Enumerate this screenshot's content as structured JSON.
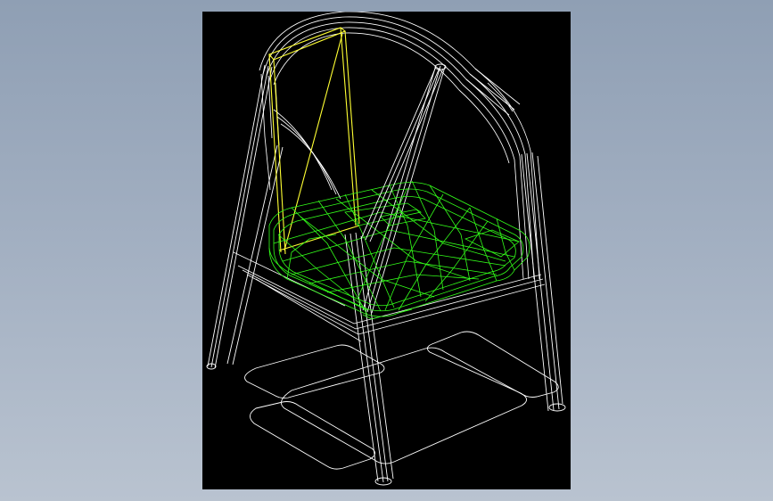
{
  "viewport": {
    "background_color": "#000000",
    "render_mode": "wireframe",
    "model": "chair"
  },
  "colors": {
    "app_background_top": "#8f9fb4",
    "app_background_bottom": "#b9c3d0",
    "frame_lines": "#ffffff",
    "seat_lines": "#33ff1a",
    "highlight_lines": "#ffff33"
  },
  "parts": [
    {
      "name": "backrest-arc",
      "color": "frame_lines"
    },
    {
      "name": "back-panel",
      "color": "highlight_lines"
    },
    {
      "name": "seat-cushion",
      "color": "seat_lines"
    },
    {
      "name": "front-left-leg",
      "color": "frame_lines"
    },
    {
      "name": "front-right-leg",
      "color": "frame_lines"
    },
    {
      "name": "rear-left-leg",
      "color": "frame_lines"
    },
    {
      "name": "rear-right-leg",
      "color": "frame_lines"
    },
    {
      "name": "floor-shadow",
      "color": "frame_lines"
    }
  ]
}
